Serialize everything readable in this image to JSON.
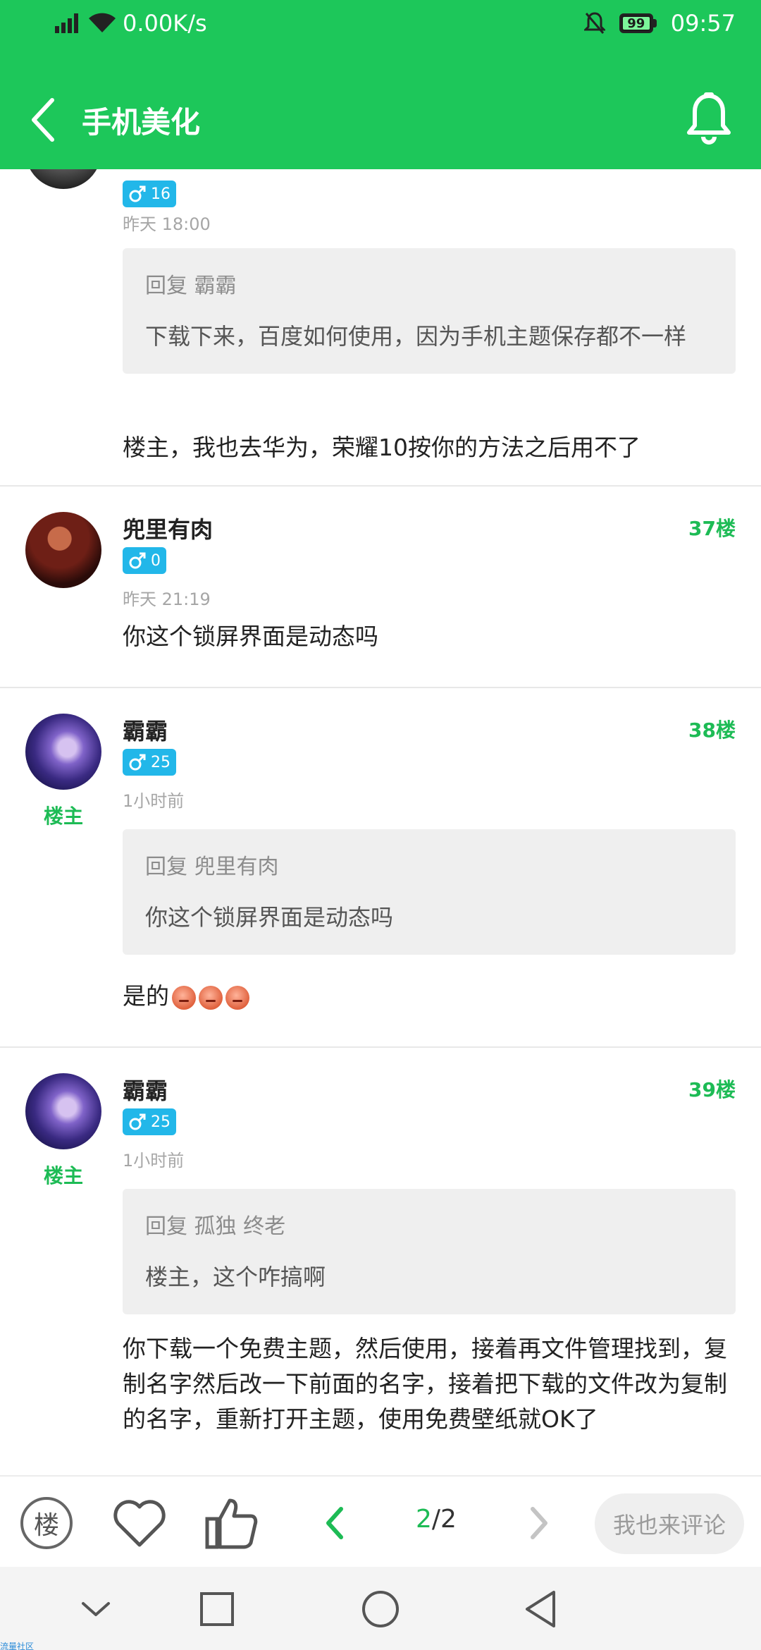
{
  "status_bar": {
    "network_speed": "0.00K/s",
    "battery": "99",
    "time": "09:57"
  },
  "header": {
    "title": "手机美化"
  },
  "posts": [
    {
      "gender_count": "16",
      "time": "昨天 18:00",
      "quote_head": "回复 霸霸",
      "quote_body": "下载下来，百度如何使用，因为手机主题保存都不一样",
      "content": "楼主，我也去华为，荣耀10按你的方法之后用不了"
    },
    {
      "username": "兜里有肉",
      "floor": "37楼",
      "gender_count": "0",
      "time": "昨天 21:19",
      "content": "你这个锁屏界面是动态吗"
    },
    {
      "username": "霸霸",
      "owner_tag": "楼主",
      "floor": "38楼",
      "gender_count": "25",
      "time": "1小时前",
      "quote_head": "回复 兜里有肉",
      "quote_body": "你这个锁屏界面是动态吗",
      "content": "是的"
    },
    {
      "username": "霸霸",
      "owner_tag": "楼主",
      "floor": "39楼",
      "gender_count": "25",
      "time": "1小时前",
      "quote_head": "回复 孤独 终老",
      "quote_body": "楼主，这个咋搞啊",
      "content": "你下载一个免费主题，然后使用，接着再文件管理找到，复制名字然后改一下前面的名字，接着把下载的文件改为复制的名字，重新打开主题，使用免费壁纸就OK了"
    }
  ],
  "toolbar": {
    "louzhu_label": "楼",
    "page_current": "2",
    "page_sep": "/",
    "page_total": "2",
    "comment_label": "我也来评论"
  },
  "watermark": "流量社区",
  "colors": {
    "brand_green": "#1dc75a",
    "floor_green": "#1dbb55",
    "gender_blue": "#22b7e9"
  },
  "icons": [
    "signal-icon",
    "wifi-icon",
    "mute-bell-icon",
    "battery-icon",
    "back-arrow-icon",
    "bell-icon",
    "male-icon",
    "heart-icon",
    "thumbs-up-icon",
    "prev-page-icon",
    "next-page-icon",
    "nav-back-icon",
    "nav-home-icon",
    "nav-recent-icon",
    "nav-collapse-icon"
  ]
}
